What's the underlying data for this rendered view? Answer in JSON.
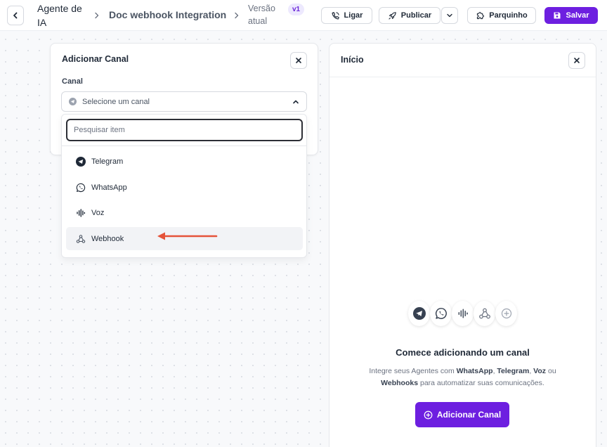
{
  "header": {
    "back_label": "",
    "agent_title": "Agente de IA",
    "doc_title": "Doc webhook Integration",
    "version_label": "Versão atual",
    "version_badge": "v1",
    "buttons": {
      "ligar": "Ligar",
      "publicar": "Publicar",
      "parquinho": "Parquinho",
      "salvar": "Salvar"
    }
  },
  "add_channel_card": {
    "title": "Adicionar Canal",
    "field_label": "Canal",
    "select_placeholder": "Selecione um canal",
    "dropdown": {
      "search_placeholder": "Pesquisar item",
      "items": [
        {
          "label": "Telegram",
          "icon": "telegram-icon"
        },
        {
          "label": "WhatsApp",
          "icon": "whatsapp-icon"
        },
        {
          "label": "Voz",
          "icon": "voice-wave-icon"
        },
        {
          "label": "Webhook",
          "icon": "webhook-icon"
        }
      ],
      "highlighted_index": 3
    }
  },
  "start_panel": {
    "title": "Início",
    "icons": [
      "telegram-icon",
      "whatsapp-icon",
      "voice-wave-icon",
      "webhook-icon",
      "plus-circle-icon"
    ],
    "empty_title": "Comece adicionando um canal",
    "empty_desc_parts": {
      "p1": "Integre seus Agentes com ",
      "b1": "WhatsApp",
      "p2": ", ",
      "b2": "Telegram",
      "p3": ", ",
      "b3": "Voz",
      "p4": " ou ",
      "b4": "Webhooks",
      "p5": " para automatizar suas comunicações."
    },
    "add_button": "Adicionar Canal"
  },
  "colors": {
    "primary": "#6d1fe0",
    "badge_bg": "#ede9fe",
    "annotation_arrow": "#e5533a"
  }
}
